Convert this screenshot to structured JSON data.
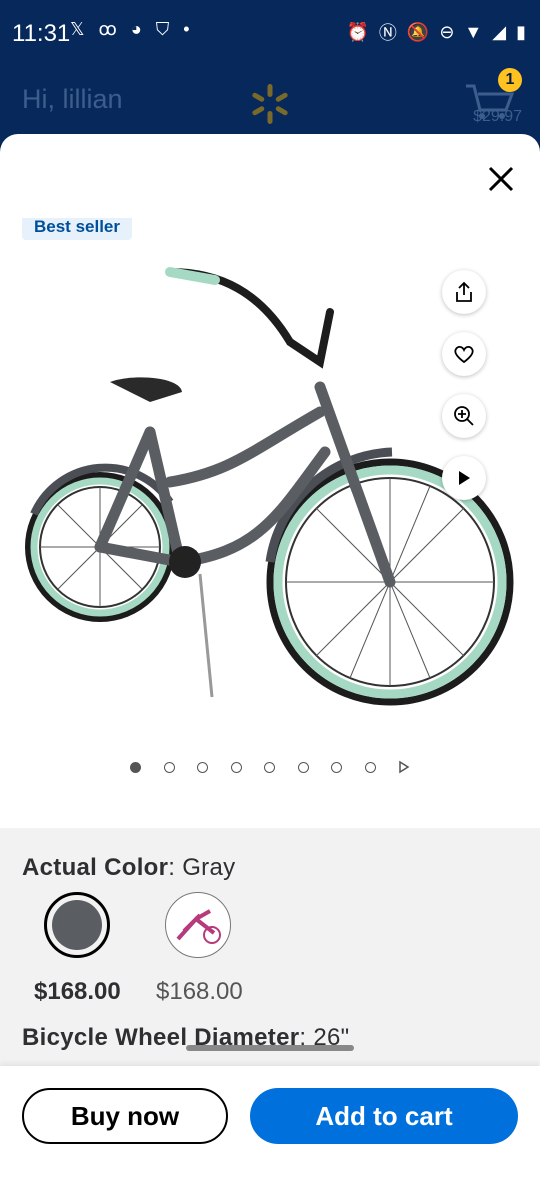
{
  "status_bar": {
    "time": "11:31",
    "left_icons": [
      "x-icon",
      "voicemail-icon",
      "app-icon",
      "shield-icon",
      "dot-icon"
    ],
    "right_icons": [
      "alarm-icon",
      "nfc-icon",
      "mute-icon",
      "dnd-icon",
      "wifi-icon",
      "signal-icon",
      "battery-icon"
    ]
  },
  "header": {
    "greeting": "Hi, lillian",
    "cart_count": "1",
    "cart_total": "$29.97",
    "brand_color": "#ffc220"
  },
  "product": {
    "badge": "Best seller",
    "image_count": 9,
    "active_image": 0,
    "actions": [
      "share-icon",
      "heart-icon",
      "zoom-icon",
      "play-icon"
    ]
  },
  "variants": {
    "color_label": "Actual Color",
    "color_value": "Gray",
    "options": [
      {
        "name": "gray",
        "price": "$168.00",
        "selected": true,
        "color": "#5a5e63"
      },
      {
        "name": "pink",
        "price": "$168.00",
        "selected": false,
        "color": "#b63a7c"
      }
    ],
    "wheel_label": "Bicycle Wheel Diameter",
    "wheel_value": "26\""
  },
  "actions": {
    "buy_now": "Buy now",
    "add_to_cart": "Add to cart",
    "accent_color": "#0071dc"
  }
}
